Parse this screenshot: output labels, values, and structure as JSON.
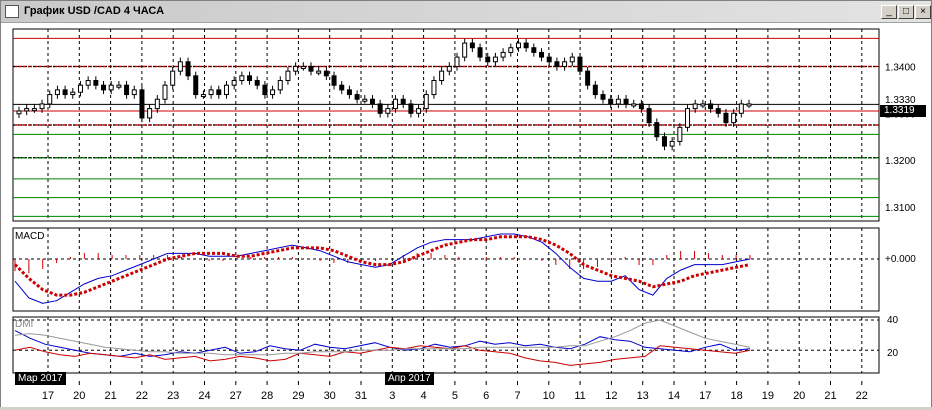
{
  "window": {
    "title": "График USD /CAD  4 ЧАСА",
    "buttons": {
      "minimize": "_",
      "maximize": "□",
      "close": "×"
    }
  },
  "colors": {
    "frame": "#000000",
    "grid": "#000000",
    "price_line_red": "#cc0000",
    "price_line_green": "#008000",
    "macd_line": "#0000cc",
    "macd_signal": "#cc0000",
    "dmi_plus": "#0000cc",
    "dmi_minus": "#cc0000",
    "adx": "#999999"
  },
  "price_panel": {
    "y_labels": [
      "1.3400",
      "1.3330",
      "1.3300",
      "1.3200",
      "1.3100"
    ],
    "current_price": "1.3319"
  },
  "macd_panel": {
    "name": "MACD",
    "zero_label": "+0.000"
  },
  "dmi_panel": {
    "name": "DMI",
    "y_labels": [
      "40",
      "20"
    ]
  },
  "period_labels": [
    "Мар 2017",
    "Апр 2017"
  ],
  "x_axis": [
    "17",
    "20",
    "21",
    "22",
    "23",
    "24",
    "27",
    "28",
    "29",
    "30",
    "31",
    "3",
    "4",
    "5",
    "6",
    "7",
    "10",
    "11",
    "12",
    "13",
    "14",
    "17",
    "18",
    "19",
    "20",
    "21",
    "22"
  ],
  "chart_data": [
    {
      "type": "candlestick",
      "title": "График USD /CAD  4 ЧАСА",
      "y_ticks": [
        1.34,
        1.333,
        1.33,
        1.32,
        1.31
      ],
      "ylim": [
        1.307,
        1.348
      ],
      "current_price": 1.3319,
      "horizontal_levels": [
        1.346,
        1.34,
        1.3305,
        1.3275,
        1.3255,
        1.3205,
        1.316,
        1.312,
        1.308
      ],
      "closes": [
        1.3305,
        1.331,
        1.331,
        1.332,
        1.334,
        1.335,
        1.334,
        1.3345,
        1.336,
        1.337,
        1.336,
        1.335,
        1.336,
        1.336,
        1.334,
        1.335,
        1.329,
        1.331,
        1.333,
        1.336,
        1.339,
        1.341,
        1.338,
        1.334,
        1.334,
        1.335,
        1.334,
        1.336,
        1.337,
        1.338,
        1.337,
        1.336,
        1.334,
        1.335,
        1.337,
        1.339,
        1.34,
        1.34,
        1.339,
        1.339,
        1.338,
        1.336,
        1.335,
        1.334,
        1.333,
        1.333,
        1.332,
        1.33,
        1.331,
        1.333,
        1.332,
        1.33,
        1.331,
        1.334,
        1.337,
        1.339,
        1.34,
        1.342,
        1.345,
        1.344,
        1.342,
        1.341,
        1.342,
        1.343,
        1.344,
        1.345,
        1.344,
        1.343,
        1.342,
        1.341,
        1.34,
        1.341,
        1.342,
        1.339,
        1.336,
        1.334,
        1.333,
        1.332,
        1.333,
        1.332,
        1.332,
        1.331,
        1.328,
        1.325,
        1.323,
        1.324,
        1.327,
        1.331,
        1.332,
        1.332,
        1.331,
        1.33,
        1.328,
        1.33,
        1.332,
        1.332
      ]
    },
    {
      "type": "line",
      "name": "MACD",
      "y_ticks": [
        0.0
      ],
      "series": [
        {
          "name": "MACD",
          "values": [
            -0.0008,
            -0.0014,
            -0.0016,
            -0.0015,
            -0.0012,
            -0.0009,
            -0.0007,
            -0.0006,
            -0.0004,
            -0.0002,
            0.0,
            0.0002,
            0.0002,
            0.0002,
            0.0001,
            0.0001,
            0.0001,
            0.0002,
            0.0003,
            0.0004,
            0.0005,
            0.0004,
            0.0003,
            0.0001,
            -0.0001,
            -0.0002,
            -0.0003,
            -0.0002,
            0.0001,
            0.0004,
            0.0006,
            0.0007,
            0.0007,
            0.0007,
            0.0008,
            0.0009,
            0.0009,
            0.0008,
            0.0006,
            0.0002,
            -0.0003,
            -0.0007,
            -0.0008,
            -0.0008,
            -0.0006,
            -0.0011,
            -0.0013,
            -0.0007,
            -0.0004,
            -0.0002,
            -0.0002,
            -0.0002,
            -0.0001,
            0.0
          ]
        },
        {
          "name": "Signal",
          "values": [
            -0.0002,
            -0.0007,
            -0.0011,
            -0.0013,
            -0.0013,
            -0.0012,
            -0.001,
            -0.0008,
            -0.0006,
            -0.0004,
            -0.0002,
            0.0,
            0.0001,
            0.0002,
            0.0002,
            0.0002,
            0.0001,
            0.0001,
            0.0002,
            0.0003,
            0.0004,
            0.0004,
            0.0004,
            0.0003,
            0.0001,
            -0.0001,
            -0.0002,
            -0.0002,
            -0.0001,
            0.0001,
            0.0003,
            0.0005,
            0.0006,
            0.0007,
            0.0007,
            0.0008,
            0.0008,
            0.0008,
            0.0007,
            0.0005,
            0.0002,
            -0.0002,
            -0.0004,
            -0.0006,
            -0.0007,
            -0.0008,
            -0.001,
            -0.0009,
            -0.0008,
            -0.0006,
            -0.0005,
            -0.0004,
            -0.0003,
            -0.0002
          ]
        }
      ]
    },
    {
      "type": "line",
      "name": "DMI",
      "y_ticks": [
        40,
        20
      ],
      "ylim": [
        5,
        42
      ],
      "series": [
        {
          "name": "+DI",
          "values": [
            33,
            28,
            24,
            22,
            20,
            18,
            17,
            16,
            18,
            16,
            17,
            19,
            18,
            20,
            22,
            18,
            19,
            23,
            21,
            20,
            24,
            22,
            21,
            23,
            25,
            22,
            20,
            21,
            24,
            22,
            23,
            26,
            24,
            25,
            23,
            24,
            22,
            21,
            24,
            29,
            27,
            26,
            22,
            21,
            20,
            19,
            22,
            24,
            20,
            21
          ]
        },
        {
          "name": "-DI",
          "values": [
            20,
            22,
            19,
            17,
            16,
            18,
            17,
            16,
            15,
            17,
            14,
            15,
            16,
            13,
            14,
            16,
            15,
            13,
            14,
            18,
            17,
            16,
            19,
            18,
            20,
            22,
            21,
            23,
            22,
            21,
            23,
            20,
            19,
            18,
            15,
            13,
            12,
            10,
            11,
            12,
            14,
            15,
            16,
            23,
            22,
            21,
            20,
            19,
            18,
            20
          ]
        },
        {
          "name": "ADX",
          "values": [
            30,
            31,
            30,
            28,
            26,
            24,
            22,
            21,
            20,
            19,
            19,
            18,
            18,
            18,
            17,
            17,
            17,
            17,
            18,
            18,
            19,
            19,
            19,
            20,
            20,
            20,
            21,
            21,
            21,
            21,
            21,
            22,
            22,
            22,
            22,
            22,
            22,
            23,
            23,
            26,
            29,
            33,
            38,
            40,
            36,
            32,
            28,
            26,
            24,
            22
          ]
        }
      ]
    }
  ]
}
